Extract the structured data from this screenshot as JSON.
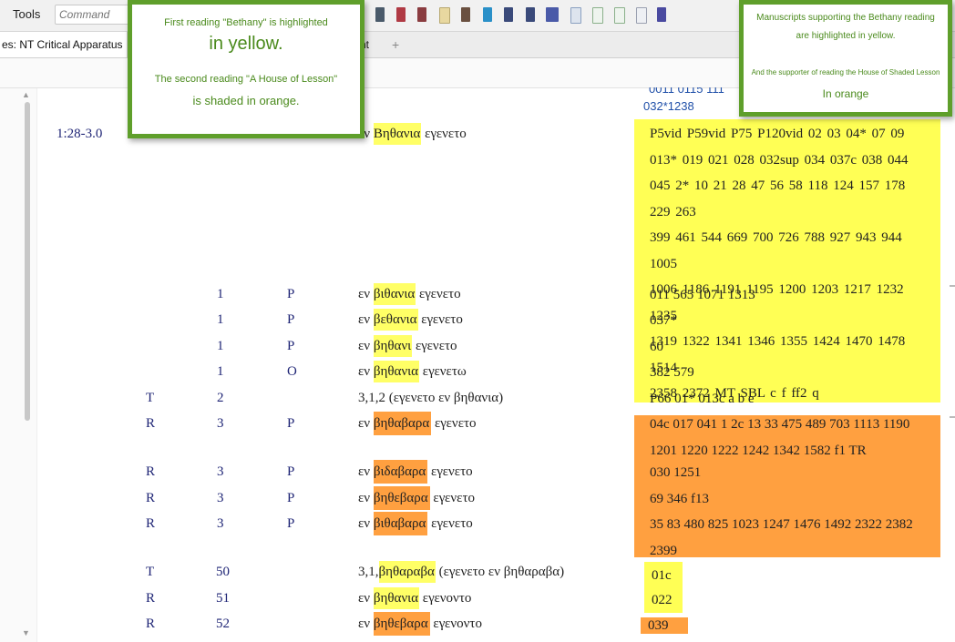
{
  "toolbar": {
    "tools_label": "Tools",
    "command_placeholder": "Command"
  },
  "tabs": {
    "active": "es: NT Critical Apparatus",
    "second": "nt",
    "add": "+"
  },
  "header_ids": {
    "partial": "0011 0115 111",
    "id": "032*1238"
  },
  "callouts": {
    "left": {
      "line1": "First reading \"Bethany\" is highlighted",
      "line2": "in yellow.",
      "line3": "The second reading \"A House of Lesson\"",
      "line4": "is shaded in orange."
    },
    "right": {
      "line1": "Manuscripts supporting the Bethany reading",
      "line2": "are highlighted in yellow.",
      "line3": "And the supporter of reading the House of Shaded Lesson",
      "line4": "In orange"
    }
  },
  "rows": [
    {
      "ref": "1:28-3.0",
      "type": "",
      "num": "",
      "code": "",
      "pre": "εν ",
      "word": "Βηθανια",
      "post": " εγενετο",
      "hl": "y",
      "witnesses": "P5vid P59vid P75 P120vid 02 03 04* 07 09\n013* 019 021 028 032sup 034 037c 038 044\n045 2* 10 21 28 47 56 58 118 124 157 178 229 263\n399 461 544 669 700 726 788 927 943 944 1005\n1006 1186 1191 1195 1200 1203 1217 1232 1235\n1319 1322 1341 1346 1355 1424 1470 1478 1514\n2358 2372 MT SBL c f ff2 q"
    },
    {
      "ref": "",
      "type": "",
      "num": "1",
      "code": "P",
      "pre": "εν ",
      "word": "βιθανια",
      "post": " εγενετο",
      "hl": "y",
      "witnesses": "011 565 1071 1313"
    },
    {
      "ref": "",
      "type": "",
      "num": "1",
      "code": "P",
      "pre": "εν ",
      "word": "βεθανια",
      "post": " εγενετο",
      "hl": "y",
      "witnesses": "037*"
    },
    {
      "ref": "",
      "type": "",
      "num": "1",
      "code": "P",
      "pre": "εν ",
      "word": "βηθανι",
      "post": " εγενετο",
      "hl": "y",
      "witnesses": "60"
    },
    {
      "ref": "",
      "type": "",
      "num": "1",
      "code": "O",
      "pre": "εν ",
      "word": "βηθανια",
      "post": " εγενετω",
      "hl": "y",
      "witnesses": "382 579"
    },
    {
      "ref": "",
      "type": "T",
      "num": "2",
      "code": "",
      "pre": "3,1,2 (εγενετο εν βηθανια)",
      "word": "",
      "post": "",
      "hl": "",
      "witnesses": "P66 01* 013c a b e"
    },
    {
      "ref": "",
      "type": "R",
      "num": "3",
      "code": "P",
      "pre": "εν ",
      "word": "βηθαβαρα",
      "post": " εγενετο",
      "hl": "o",
      "witnesses": "04c 017 041 1 2c 13 33 475 489 703 1113 1190\n1201 1220 1222 1242 1342 1582 f1 TR"
    },
    {
      "ref": "",
      "type": "R",
      "num": "3",
      "code": "P",
      "pre": "εν ",
      "word": "βιδαβαρα",
      "post": " εγενετο",
      "hl": "o",
      "witnesses": "030 1251"
    },
    {
      "ref": "",
      "type": "R",
      "num": "3",
      "code": "P",
      "pre": "εν ",
      "word": "βηθεβαρα",
      "post": " εγενετο",
      "hl": "o",
      "witnesses": "69 346 f13"
    },
    {
      "ref": "",
      "type": "R",
      "num": "3",
      "code": "P",
      "pre": "εν ",
      "word": "βιθαβαρα",
      "post": " εγενετο",
      "hl": "o",
      "witnesses": "35 83 480 825 1023 1247 1476 1492 2322 2382\n2399"
    },
    {
      "ref": "",
      "type": "T",
      "num": "50",
      "code": "",
      "pre": "3,1,",
      "word": "βηθαραβα",
      "post": " (εγενετο εν βηθαραβα)",
      "hl": "y",
      "witnesses": "01c"
    },
    {
      "ref": "",
      "type": "R",
      "num": "51",
      "code": "",
      "pre": "εν ",
      "word": "βηθανια",
      "post": " εγενοντο",
      "hl": "y",
      "witnesses": "022"
    },
    {
      "ref": "",
      "type": "R",
      "num": "52",
      "code": "",
      "pre": "εν ",
      "word": "βηθεβαρα",
      "post": " εγενοντο",
      "hl": "o",
      "witnesses": "039"
    }
  ],
  "colors": {
    "yellow": "#ffff55",
    "orange": "#ffa040",
    "callout_border": "#5f9f2b",
    "callout_text": "#4a8a1c",
    "index_text": "#1e2475"
  }
}
